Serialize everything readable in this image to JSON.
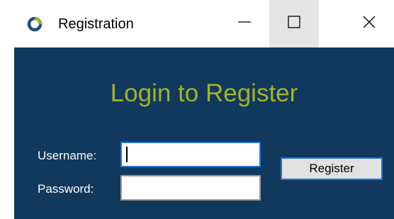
{
  "window": {
    "title": "Registration",
    "icon": "app-refresh-icon",
    "controls": {
      "minimize": "minimize-icon",
      "maximize": "maximize-icon",
      "close": "close-icon"
    }
  },
  "form": {
    "heading": "Login to Register",
    "username_label": "Username:",
    "username_value": "",
    "password_label": "Password:",
    "password_value": "",
    "register_label": "Register"
  },
  "colors": {
    "client_background": "#11385d",
    "heading": "#a4b427",
    "focus_border": "#2277d6"
  }
}
